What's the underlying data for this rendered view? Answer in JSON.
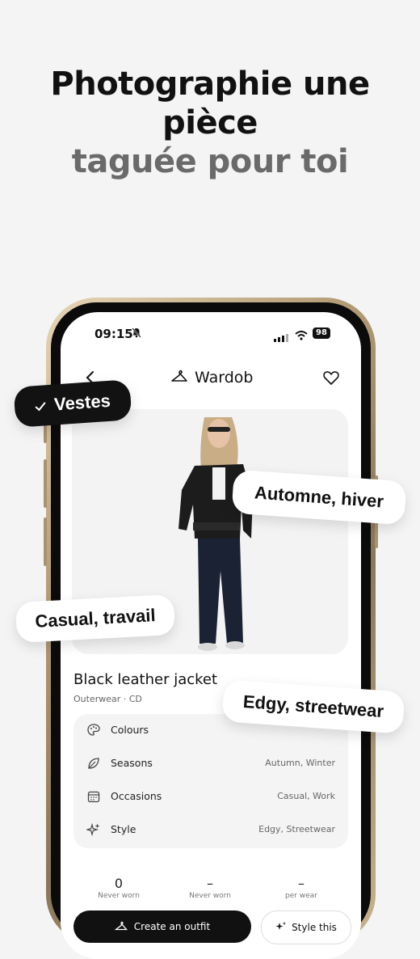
{
  "headline": {
    "line1": "Photographie une pièce",
    "line2": "taguée pour toi"
  },
  "status_bar": {
    "time": "09:15",
    "battery": "98"
  },
  "app": {
    "name": "Wardob"
  },
  "item": {
    "title": "Black leather jacket",
    "subtitle": "Outerwear · CD"
  },
  "attributes": [
    {
      "label": "Colours",
      "value": "",
      "icon": "palette-icon"
    },
    {
      "label": "Seasons",
      "value": "Autumn, Winter",
      "icon": "leaf-icon"
    },
    {
      "label": "Occasions",
      "value": "Casual, Work",
      "icon": "calendar-icon"
    },
    {
      "label": "Style",
      "value": "Edgy, Streetwear",
      "icon": "sparkles-icon"
    }
  ],
  "stats": [
    {
      "value": "0",
      "label": "Never worn"
    },
    {
      "value": "–",
      "label": "Never worn"
    },
    {
      "value": "–",
      "label": "per wear"
    }
  ],
  "buttons": {
    "primary": "Create an outfit",
    "secondary": "Style this"
  },
  "tags": {
    "category": "Vestes",
    "season": "Automne, hiver",
    "occasion": "Casual, travail",
    "style": "Edgy, streetwear"
  },
  "colors": {
    "background": "#f4f4f4",
    "accent": "#111111",
    "frame": "#b59d77"
  }
}
